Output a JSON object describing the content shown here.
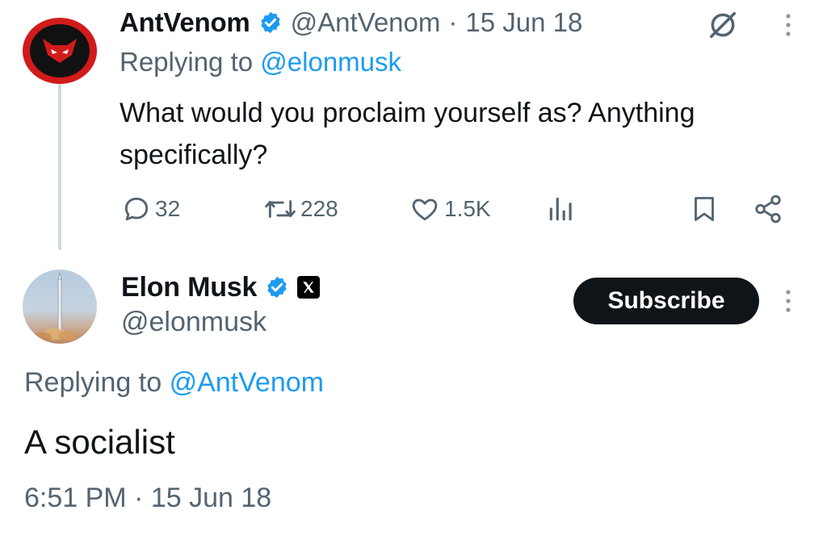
{
  "reply_tweet": {
    "author_name": "AntVenom",
    "author_handle": "@AntVenom",
    "separator": "·",
    "date": "15 Jun 18",
    "replying_prefix": "Replying to",
    "replying_to": "@elonmusk",
    "text": "What would you proclaim yourself as? Anything specifically?",
    "stats": {
      "replies": "32",
      "retweets": "228",
      "likes": "1.5K"
    },
    "icons": [
      "reply-icon",
      "retweet-icon",
      "like-icon",
      "views-icon",
      "bookmark-icon",
      "share-icon",
      "grok-icon",
      "more-icon"
    ]
  },
  "main_tweet": {
    "author_name": "Elon Musk",
    "author_handle": "@elonmusk",
    "subscribe_label": "Subscribe",
    "replying_prefix": "Replying to",
    "replying_to": "@AntVenom",
    "text": "A socialist",
    "timestamp": "6:51 PM · 15 Jun 18"
  },
  "colors": {
    "accent": "#1d9bf0",
    "muted": "#536471",
    "text": "#0f1419",
    "thread_line": "#cfd9de",
    "avatar_ring": "#d11b1b"
  }
}
